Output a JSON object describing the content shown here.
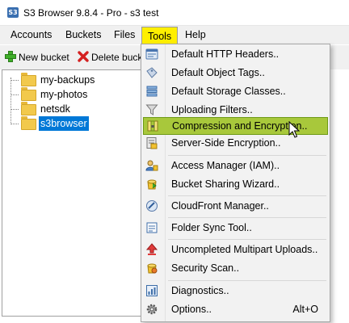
{
  "window": {
    "title": "S3 Browser 9.8.4 - Pro - s3 test",
    "icon_label": "S3"
  },
  "menubar": {
    "items": [
      {
        "label": "Accounts"
      },
      {
        "label": "Buckets"
      },
      {
        "label": "Files"
      },
      {
        "label": "Tools"
      },
      {
        "label": "Help"
      }
    ],
    "open": "Tools"
  },
  "toolbar": {
    "new_bucket": "New bucket",
    "delete_bucket": "Delete buck"
  },
  "tree": {
    "items": [
      {
        "label": "my-backups"
      },
      {
        "label": "my-photos"
      },
      {
        "label": "netsdk"
      },
      {
        "label": "s3browser",
        "selected": true
      }
    ]
  },
  "tools_menu": {
    "items": [
      {
        "label": "Default HTTP Headers..",
        "icon": "http-headers-icon"
      },
      {
        "label": "Default Object Tags..",
        "icon": "tags-icon"
      },
      {
        "label": "Default Storage Classes..",
        "icon": "storage-classes-icon"
      },
      {
        "label": "Uploading Filters..",
        "icon": "filter-icon"
      },
      {
        "label": "Compression and Encryption..",
        "icon": "compression-icon",
        "highlighted": true
      },
      {
        "label": "Server-Side Encryption..",
        "icon": "server-encryption-icon"
      },
      {
        "label": "Access Manager (IAM)..",
        "icon": "access-manager-icon"
      },
      {
        "label": "Bucket Sharing Wizard..",
        "icon": "sharing-icon"
      },
      {
        "label": "CloudFront Manager..",
        "icon": "cloudfront-icon"
      },
      {
        "label": "Folder Sync Tool..",
        "icon": "folder-sync-icon"
      },
      {
        "label": "Uncompleted Multipart Uploads..",
        "icon": "multipart-upload-icon"
      },
      {
        "label": "Security Scan..",
        "icon": "security-scan-icon"
      },
      {
        "label": "Diagnostics..",
        "icon": "diagnostics-icon"
      },
      {
        "label": "Options..",
        "icon": "gear-icon",
        "shortcut": "Alt+O"
      }
    ]
  },
  "colors": {
    "menu_open_bg": "#ffef00",
    "highlight_bg": "#a8c83b",
    "selection_bg": "#0078d7"
  }
}
